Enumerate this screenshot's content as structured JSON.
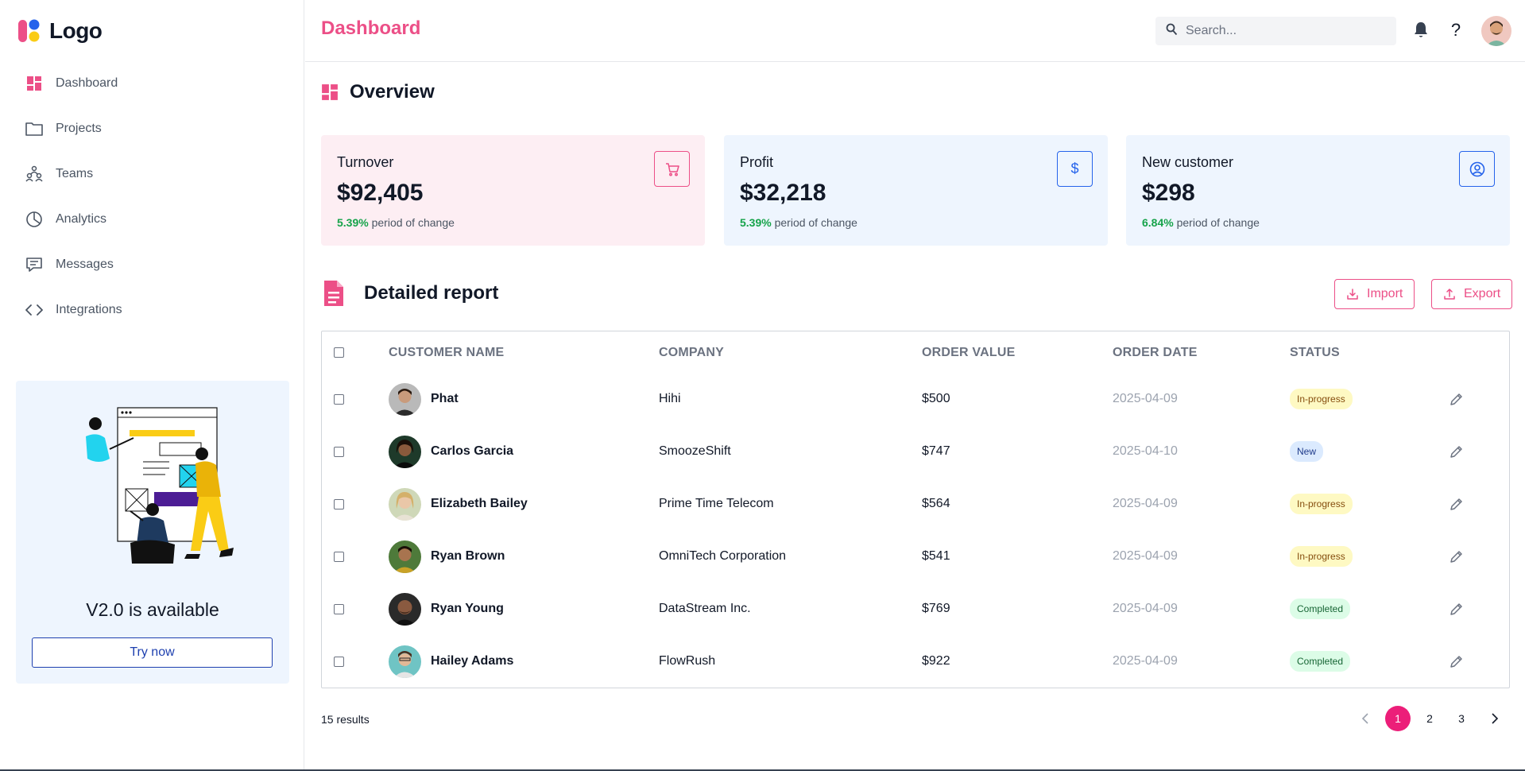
{
  "brand": {
    "logo_text": "Logo"
  },
  "sidebar": {
    "items": [
      {
        "label": "Dashboard",
        "icon": "dashboard-icon"
      },
      {
        "label": "Projects",
        "icon": "folder-icon"
      },
      {
        "label": "Teams",
        "icon": "teams-icon"
      },
      {
        "label": "Analytics",
        "icon": "pie-chart-icon"
      },
      {
        "label": "Messages",
        "icon": "message-icon"
      },
      {
        "label": "Integrations",
        "icon": "code-icon"
      }
    ],
    "promo": {
      "title": "V2.0 is available",
      "button": "Try now"
    }
  },
  "header": {
    "title": "Dashboard",
    "search_placeholder": "Search..."
  },
  "overview": {
    "title": "Overview",
    "cards": [
      {
        "label": "Turnover",
        "value": "$92,405",
        "change": "5.39%",
        "change_text": "period of change",
        "icon": "cart-icon"
      },
      {
        "label": "Profit",
        "value": "$32,218",
        "change": "5.39%",
        "change_text": "period of change",
        "icon": "dollar-icon"
      },
      {
        "label": "New customer",
        "value": "$298",
        "change": "6.84%",
        "change_text": "period of change",
        "icon": "user-circle-icon"
      }
    ]
  },
  "report": {
    "title": "Detailed report",
    "import_label": "Import",
    "export_label": "Export",
    "columns": [
      "CUSTOMER NAME",
      "COMPANY",
      "ORDER VALUE",
      "ORDER DATE",
      "STATUS"
    ],
    "rows": [
      {
        "name": "Phat",
        "company": "Hihi",
        "value": "$500",
        "date": "2025-04-09",
        "status": "In-progress"
      },
      {
        "name": "Carlos Garcia",
        "company": "SmoozeShift",
        "value": "$747",
        "date": "2025-04-10",
        "status": "New"
      },
      {
        "name": "Elizabeth Bailey",
        "company": "Prime Time Telecom",
        "value": "$564",
        "date": "2025-04-09",
        "status": "In-progress"
      },
      {
        "name": "Ryan Brown",
        "company": "OmniTech Corporation",
        "value": "$541",
        "date": "2025-04-09",
        "status": "In-progress"
      },
      {
        "name": "Ryan Young",
        "company": "DataStream Inc.",
        "value": "$769",
        "date": "2025-04-09",
        "status": "Completed"
      },
      {
        "name": "Hailey Adams",
        "company": "FlowRush",
        "value": "$922",
        "date": "2025-04-09",
        "status": "Completed"
      }
    ],
    "results_text": "15 results",
    "pages": [
      "1",
      "2",
      "3"
    ],
    "current_page": "1"
  },
  "colors": {
    "accent": "#ec4f87",
    "page_active": "#ec1e79",
    "blue": "#2563eb",
    "green": "#16a34a"
  }
}
